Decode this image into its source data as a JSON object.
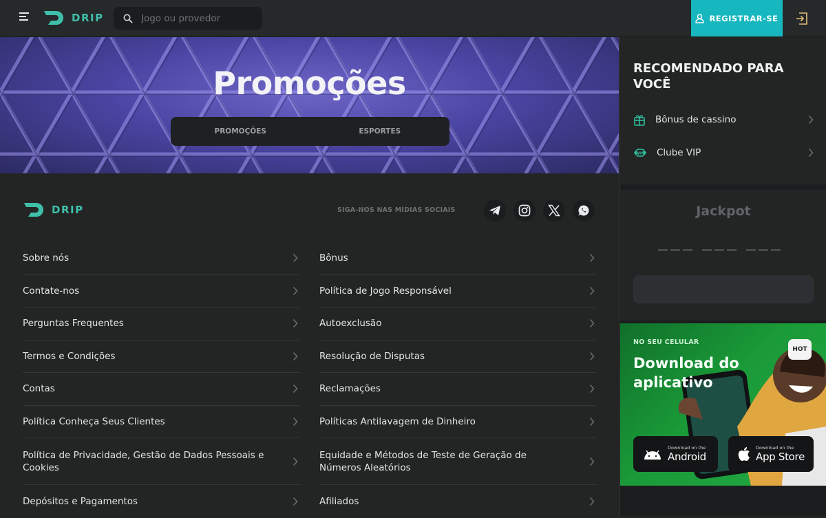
{
  "header": {
    "logo_text": "DRIP",
    "search_placeholder": "Jogo ou provedor",
    "register_label": "REGISTRAR-SE",
    "accent_color": "#17b7bf"
  },
  "hero": {
    "title": "Promoções",
    "tabs": [
      {
        "label": "PROMOÇÕES"
      },
      {
        "label": "ESPORTES"
      }
    ]
  },
  "footer": {
    "logo_text": "DRIP",
    "social_label": "SIGA-NOS NAS MÍDIAS SOCIAIS",
    "social": [
      "telegram-icon",
      "instagram-icon",
      "x-icon",
      "whatsapp-icon"
    ],
    "left_links": [
      {
        "label": "Sobre nós"
      },
      {
        "label": "Contate-nos"
      },
      {
        "label": "Perguntas Frequentes"
      },
      {
        "label": "Termos e Condições"
      },
      {
        "label": "Contas"
      },
      {
        "label": "Política Conheça Seus Clientes"
      },
      {
        "label": "Política de Privacidade, Gestão de Dados Pessoais e Cookies"
      },
      {
        "label": "Depósitos e Pagamentos"
      }
    ],
    "right_links": [
      {
        "label": "Bônus"
      },
      {
        "label": "Política de Jogo Responsável"
      },
      {
        "label": "Autoexclusão"
      },
      {
        "label": "Resolução de Disputas"
      },
      {
        "label": "Reclamações"
      },
      {
        "label": "Políticas Antilavagem de Dinheiro"
      },
      {
        "label": "Equidade e Métodos de Teste de Geração de Números Aleatórios"
      },
      {
        "label": "Afiliados"
      }
    ]
  },
  "sidebar": {
    "recommended_title": "RECOMENDADO PARA VOCÊ",
    "items": [
      {
        "label": "Bônus de cassino",
        "icon": "gift-icon"
      },
      {
        "label": "Clube VIP",
        "icon": "vip-icon"
      }
    ],
    "jackpot_title": "Jackpot",
    "app": {
      "label": "NO SEU CELULAR",
      "title": "Download do aplicativo",
      "badge": "HOT",
      "android_small": "Download on the",
      "android_big": "Android",
      "ios_small": "Download on the",
      "ios_big": "App Store"
    }
  }
}
